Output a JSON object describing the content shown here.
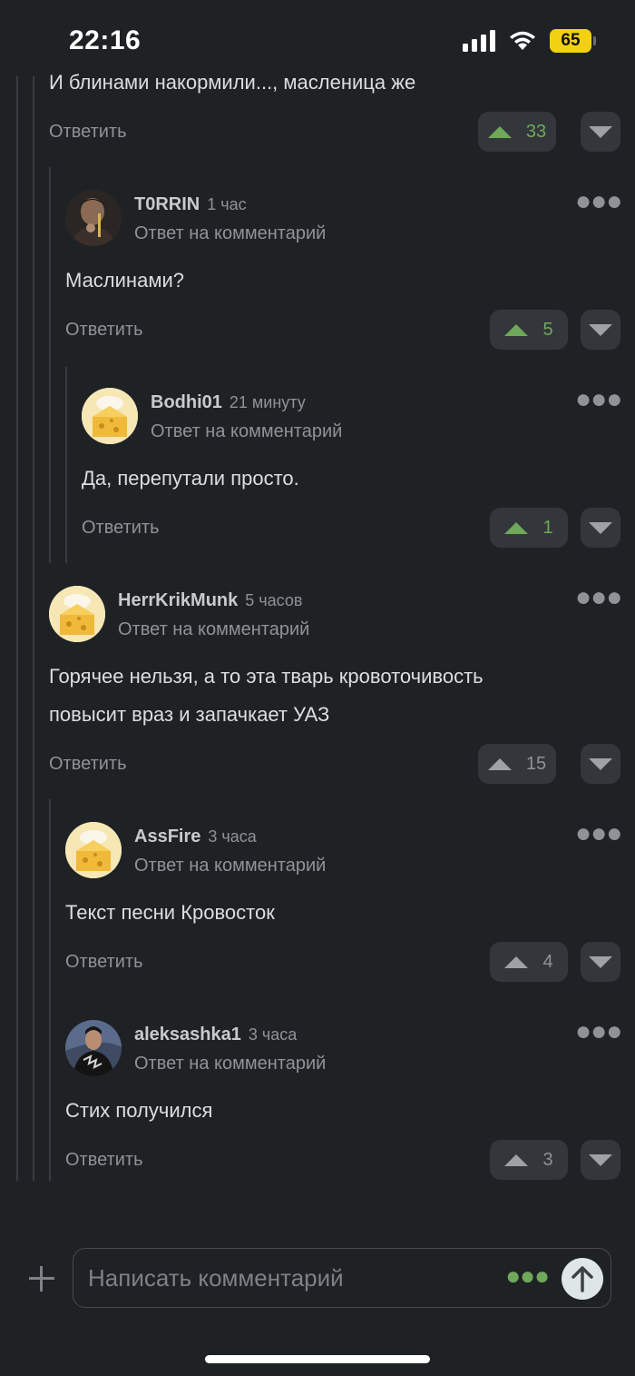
{
  "status_bar": {
    "time": "22:16",
    "battery": "65"
  },
  "top_comment": {
    "text": "И блинами накормили..., масленица же",
    "reply_label": "Ответить",
    "votes": "33"
  },
  "comments": [
    {
      "username": "T0RRIN",
      "time": "1 час",
      "reply_to": "Ответ на комментарий",
      "text": "Маслинами?",
      "reply_label": "Ответить",
      "votes": "5"
    },
    {
      "username": "Bodhi01",
      "time": "21 минуту",
      "reply_to": "Ответ на комментарий",
      "text": "Да, перепутали просто.",
      "reply_label": "Ответить",
      "votes": "1"
    },
    {
      "username": "HerrKrikMunk",
      "time": "5 часов",
      "reply_to": "Ответ на комментарий",
      "text_line1": "Горячее нельзя, а то эта тварь кровоточивость",
      "text_line2": "повысит враз и запачкает УАЗ",
      "reply_label": "Ответить",
      "votes": "15"
    },
    {
      "username": "AssFire",
      "time": "3 часа",
      "reply_to": "Ответ на комментарий",
      "text": "Текст песни Кровосток",
      "reply_label": "Ответить",
      "votes": "4"
    },
    {
      "username": "aleksashka1",
      "time": "3 часа",
      "reply_to": "Ответ на комментарий",
      "text": "Стих получился",
      "reply_label": "Ответить",
      "votes": "3"
    }
  ],
  "composer": {
    "placeholder": "Написать комментарий"
  },
  "colors": {
    "background": "#1f2225",
    "upvoted": "#6fa85b",
    "vote_bg": "#33373b"
  },
  "icons": [
    "signal-icon",
    "wifi-icon",
    "battery-icon",
    "upvote-icon",
    "downvote-icon",
    "more-icon",
    "plus-icon",
    "send-arrow-icon"
  ]
}
